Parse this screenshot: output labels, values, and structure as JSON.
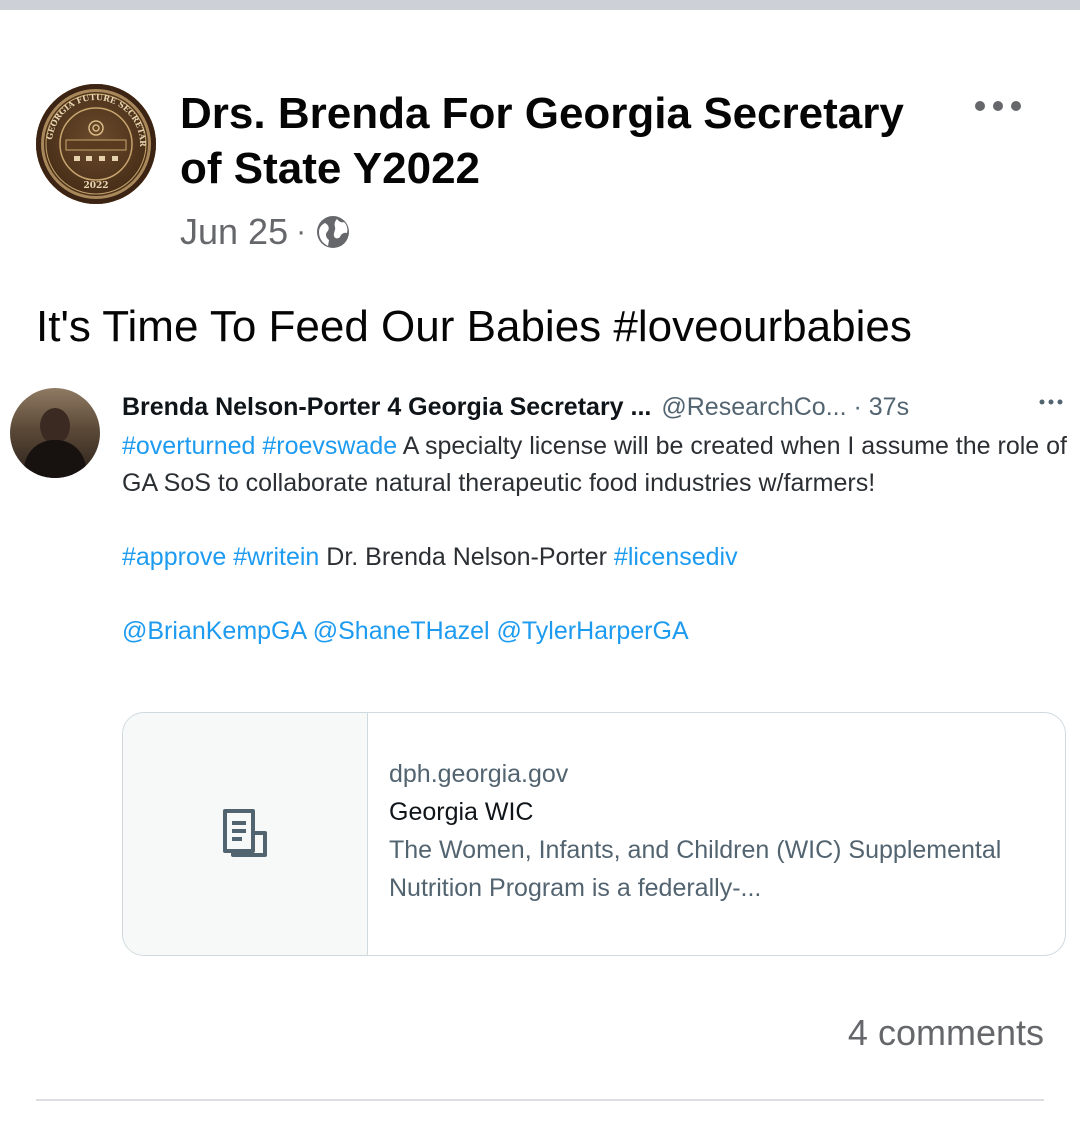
{
  "post": {
    "page_name": "Drs. Brenda For Georgia Secretary of State Y2022",
    "date": "Jun 25",
    "separator": "·",
    "text": "It's Time To Feed Our Babies #loveourbabies",
    "comments_count": "4 comments",
    "icons": {
      "more": "more-horizontal-icon",
      "privacy": "globe-icon",
      "avatar": "seal-logo"
    },
    "avatar_logo_text": {
      "outer_ring": "GEORGIA FUTURE SECRETARY OF STATE",
      "year": "2022"
    }
  },
  "tweet": {
    "author_name": "Brenda Nelson-Porter 4 Georgia Secretary ...",
    "handle": "@ResearchCo...",
    "time": "· 37s",
    "line1_tags": "#overturned #roevswade",
    "line1_text": " A specialty license will be created when I assume the role of GA SoS to collaborate natural therapeutic food industries w/farmers!",
    "line2_tags_a": "#approve #writein",
    "line2_text": " Dr. Brenda Nelson-Porter ",
    "line2_tags_b": "#licensediv",
    "mentions": "@BrianKempGA @ShaneTHazel @TylerHarperGA",
    "link_card": {
      "domain": "dph.georgia.gov",
      "title": "Georgia WIC",
      "description": "The Women, Infants, and Children (WIC) Supplemental Nutrition Program is a federally-...",
      "thumb_icon": "document-icon"
    }
  },
  "colors": {
    "link_blue": "#1d9bf0",
    "muted_text": "#65676b",
    "primary_text": "#050505"
  }
}
